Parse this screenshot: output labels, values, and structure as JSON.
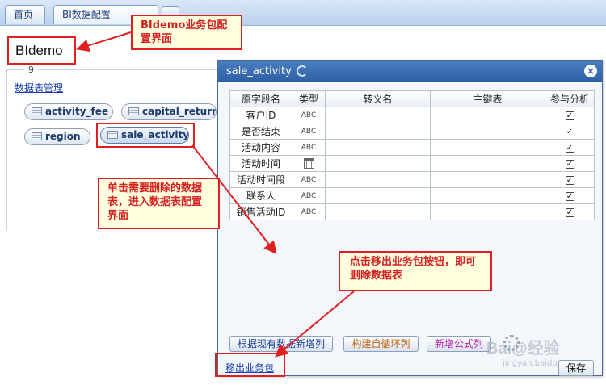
{
  "tabs": {
    "home": "首页",
    "bi_config": "BI数据配置"
  },
  "package": {
    "name": "BIdemo",
    "count": "9",
    "manage_link": "数据表管理"
  },
  "tables": [
    "activity_fee",
    "capital_return",
    "region",
    "sale_activity"
  ],
  "callouts": {
    "config": "BIdemo业务包配置界面",
    "select_table": "单击需要删除的数据表，进入数据表配置界面",
    "remove": "点击移出业务包按钮，即可删除数据表"
  },
  "dialog": {
    "title": "sale_activity",
    "columns": [
      "原字段名",
      "类型",
      "转义名",
      "主键表",
      "参与分析"
    ],
    "rows": [
      {
        "name": "客户ID",
        "type": "ABC",
        "alias": "",
        "key": "",
        "checked": true
      },
      {
        "name": "是否结束",
        "type": "ABC",
        "alias": "",
        "key": "",
        "checked": true
      },
      {
        "name": "活动内容",
        "type": "ABC",
        "alias": "",
        "key": "",
        "checked": true
      },
      {
        "name": "活动时间",
        "type": "calendar-icon",
        "alias": "",
        "key": "",
        "checked": true
      },
      {
        "name": "活动时间段",
        "type": "ABC",
        "alias": "",
        "key": "",
        "checked": true
      },
      {
        "name": "联系人",
        "type": "ABC",
        "alias": "",
        "key": "",
        "checked": true
      },
      {
        "name": "销售活动ID",
        "type": "ABC",
        "alias": "",
        "key": "",
        "checked": true
      }
    ],
    "buttons": {
      "add_from_data": "根据现有数据新增列",
      "build_loop": "构建自循环列",
      "add_formula": "新增公式列",
      "save": "保存"
    },
    "remove_link": "移出业务包",
    "watermark": "Bai@经验",
    "watermark_sub": "jingyan.baidu.com"
  },
  "colors": {
    "annotation": "#e02020",
    "callout_bg": "#ffffe0",
    "dialog_header": "#3a6db3"
  }
}
